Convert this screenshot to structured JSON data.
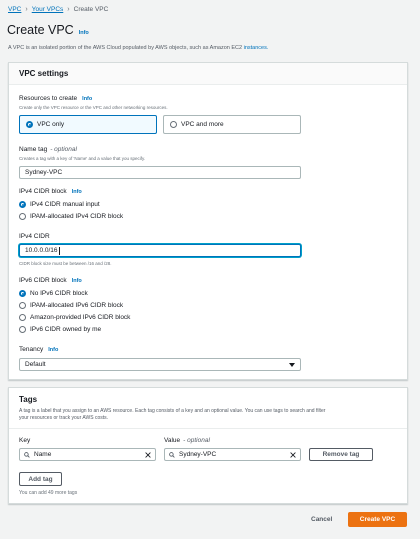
{
  "breadcrumb": {
    "items": [
      "VPC",
      "Your VPCs"
    ],
    "current": "Create VPC"
  },
  "page": {
    "title": "Create VPC",
    "info": "Info",
    "description": "A VPC is an isolated portion of the AWS Cloud populated by AWS objects, such as Amazon EC2 ",
    "description_link": "instances."
  },
  "vpc_settings": {
    "header": "VPC settings",
    "resources": {
      "label": "Resources to create",
      "info": "Info",
      "desc": "Create only the VPC resource or the VPC and other networking resources.",
      "options": [
        "VPC only",
        "VPC and more"
      ],
      "selected": 0
    },
    "name_tag": {
      "label": "Name tag",
      "optional": "- optional",
      "desc": "Creates a tag with a key of 'Name' and a value that you specify.",
      "value": "Sydney-VPC"
    },
    "ipv4_block": {
      "label": "IPv4 CIDR block",
      "info": "Info",
      "options": [
        "IPv4 CIDR manual input",
        "IPAM-allocated IPv4 CIDR block"
      ],
      "selected": 0
    },
    "ipv4_cidr": {
      "label": "IPv4 CIDR",
      "value": "10.0.0.0/16",
      "constraint": "CIDR block size must be between /16 and /28."
    },
    "ipv6_block": {
      "label": "IPv6 CIDR block",
      "info": "Info",
      "options": [
        "No IPv6 CIDR block",
        "IPAM-allocated IPv6 CIDR block",
        "Amazon-provided IPv6 CIDR block",
        "IPv6 CIDR owned by me"
      ],
      "selected": 0
    },
    "tenancy": {
      "label": "Tenancy",
      "info": "Info",
      "value": "Default"
    }
  },
  "tags": {
    "header": "Tags",
    "desc_line1": "A tag is a label that you assign to an AWS resource. Each tag consists of a key and an optional value. You can use tags to search and filter",
    "desc_line2": "your resources or track your AWS costs.",
    "key_label": "Key",
    "value_label": "Value",
    "value_optional": "- optional",
    "rows": [
      {
        "key": "Name",
        "value": "Sydney-VPC"
      }
    ],
    "remove_label": "Remove tag",
    "add_label": "Add tag",
    "limit_note": "You can add 49 more tags"
  },
  "footer": {
    "cancel": "Cancel",
    "submit": "Create VPC"
  },
  "colors": {
    "primary": "#ec7211",
    "link": "#0073bb",
    "selected_border": "#0073bb"
  }
}
